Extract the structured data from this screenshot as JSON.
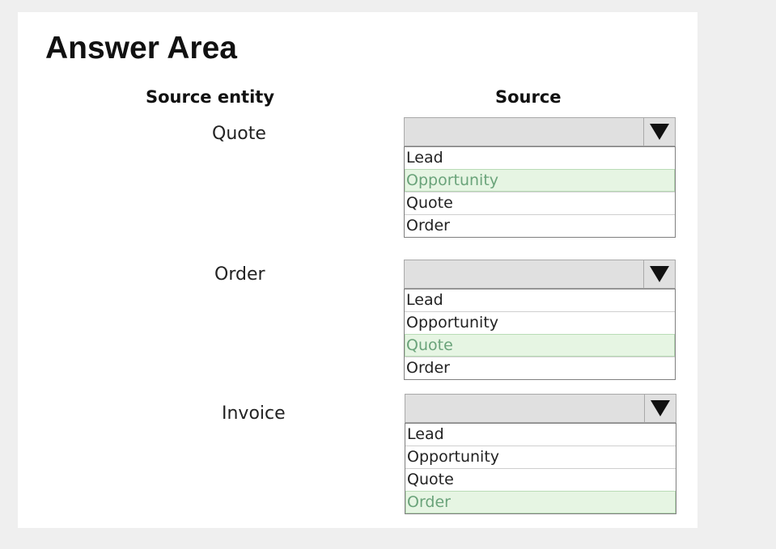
{
  "title": "Answer Area",
  "headers": {
    "source_entity": "Source entity",
    "source": "Source"
  },
  "rows": [
    {
      "entity": "Quote",
      "options": [
        "Lead",
        "Opportunity",
        "Quote",
        "Order"
      ],
      "selected": "Opportunity"
    },
    {
      "entity": "Order",
      "options": [
        "Lead",
        "Opportunity",
        "Quote",
        "Order"
      ],
      "selected": "Quote"
    },
    {
      "entity": "Invoice",
      "options": [
        "Lead",
        "Opportunity",
        "Quote",
        "Order"
      ],
      "selected": "Order"
    }
  ],
  "colors": {
    "selected_bg": "#e6f5e3",
    "selected_text": "#6aa37a",
    "dropdown_bg": "#e0e0e0"
  },
  "icons": {
    "dropdown_arrow": "triangle-down-icon"
  }
}
